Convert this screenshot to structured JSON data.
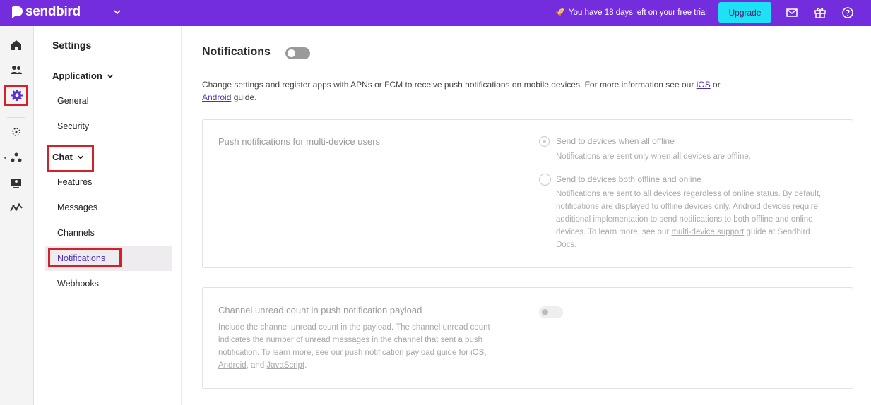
{
  "app": {
    "logo": "sendbird"
  },
  "topbar": {
    "trial_text": "You have 18 days left on your free trial",
    "upgrade_label": "Upgrade",
    "icons": [
      "mail-icon",
      "gift-icon",
      "help-icon"
    ],
    "background": "#742ddd",
    "upgrade_color": "#1fe1f5"
  },
  "rail": {
    "icons": [
      "home-icon",
      "users-icon",
      "settings-icon",
      "target-icon",
      "analytics-icon",
      "moderation-icon",
      "activity-icon"
    ],
    "active": "settings-icon"
  },
  "nav": {
    "title": "Settings",
    "groups": [
      {
        "label": "Application",
        "items": [
          "General",
          "Security"
        ]
      },
      {
        "label": "Chat",
        "items": [
          "Features",
          "Messages",
          "Channels",
          "Notifications",
          "Webhooks"
        ]
      }
    ],
    "active_item": "Notifications"
  },
  "main": {
    "title": "Notifications",
    "description_prefix": "Change settings and register apps with APNs or FCM to receive push notifications on mobile devices. For more information see our",
    "ios_link": "iOS",
    "or_text": "or",
    "android_link": "Android",
    "guide_text": "guide.",
    "multi_device": {
      "label": "Push notifications for multi-device users",
      "option1_label": "Send to devices when all offline",
      "option1_help": "Notifications are sent only when all devices are offline.",
      "option2_label": "Send to devices both offline and online",
      "option2_help": "Notifications are sent to all devices regardless of online status. By default, notifications are displayed to offline devices only. Android devices require additional implementation to send notifications to both offline and online devices. To learn more, see our",
      "option2_link": "multi-device support",
      "option2_suffix": "guide at Sendbird Docs."
    },
    "unread_count": {
      "label": "Channel unread count in push notification payload",
      "help": "Include the channel unread count in the payload. The channel unread count indicates the number of unread messages in the channel that sent a push notification. To learn more, see our push notification payload guide for",
      "link_ios": "iOS",
      "link_android": "Android",
      "and_text": ", and",
      "link_js": "JavaScript"
    }
  }
}
